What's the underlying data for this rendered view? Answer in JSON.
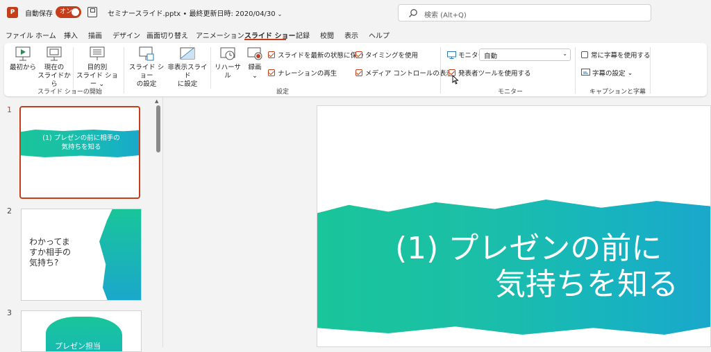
{
  "titlebar": {
    "app_icon": "powerpoint-logo",
    "autosave_label": "自動保存",
    "autosave_state": "オン",
    "doc_title": "セミナースライド.pptx • 最終更新日時: 2020/04/30",
    "search_placeholder": "検索 (Alt+Q)"
  },
  "tabs": [
    "ファイル",
    "ホーム",
    "挿入",
    "描画",
    "デザイン",
    "画面切り替え",
    "アニメーション",
    "スライド ショー",
    "記録",
    "校閲",
    "表示",
    "ヘルプ"
  ],
  "active_tab": "スライド ショー",
  "ribbon": {
    "start_group": {
      "label": "スライド ショーの開始",
      "from_start": "最初から",
      "from_current_1": "現在の",
      "from_current_2": "スライドから",
      "custom_1": "目的別",
      "custom_2": "スライド ショー"
    },
    "setup_group": {
      "label": "設定",
      "setup_1": "スライド ショー",
      "setup_2": "の設定",
      "hide_1": "非表示スライド",
      "hide_2": "に設定",
      "rehearse": "リハーサル",
      "record": "録画",
      "keep_updated": "スライドを最新の状態に保つ",
      "play_narration": "ナレーションの再生",
      "use_timings": "タイミングを使用",
      "show_media": "メディア コントロールの表示"
    },
    "monitor_group": {
      "label": "モニター",
      "monitor_label": "モニター:",
      "monitor_value": "自動",
      "presenter_view": "発表者ツールを使用する"
    },
    "captions_group": {
      "label": "キャプションと字幕",
      "always_subtitles": "常に字幕を使用する",
      "subtitle_settings": "字幕の設定"
    }
  },
  "slides": [
    {
      "number": "1",
      "title_1": "(1) プレゼンの前に相手の",
      "title_2": "気持ちを知る"
    },
    {
      "number": "2",
      "text_1": "わかってま",
      "text_2": "すか相手の",
      "text_3": "気持ち?"
    },
    {
      "number": "3",
      "text_1": "プレゼン担当"
    }
  ],
  "main_slide": {
    "title_1": "(1) プレゼンの前に",
    "title_2": "気持ちを知る"
  },
  "colors": {
    "accent": "#c43e1c",
    "band_start": "#19c59a",
    "band_end": "#1aa7cc"
  }
}
